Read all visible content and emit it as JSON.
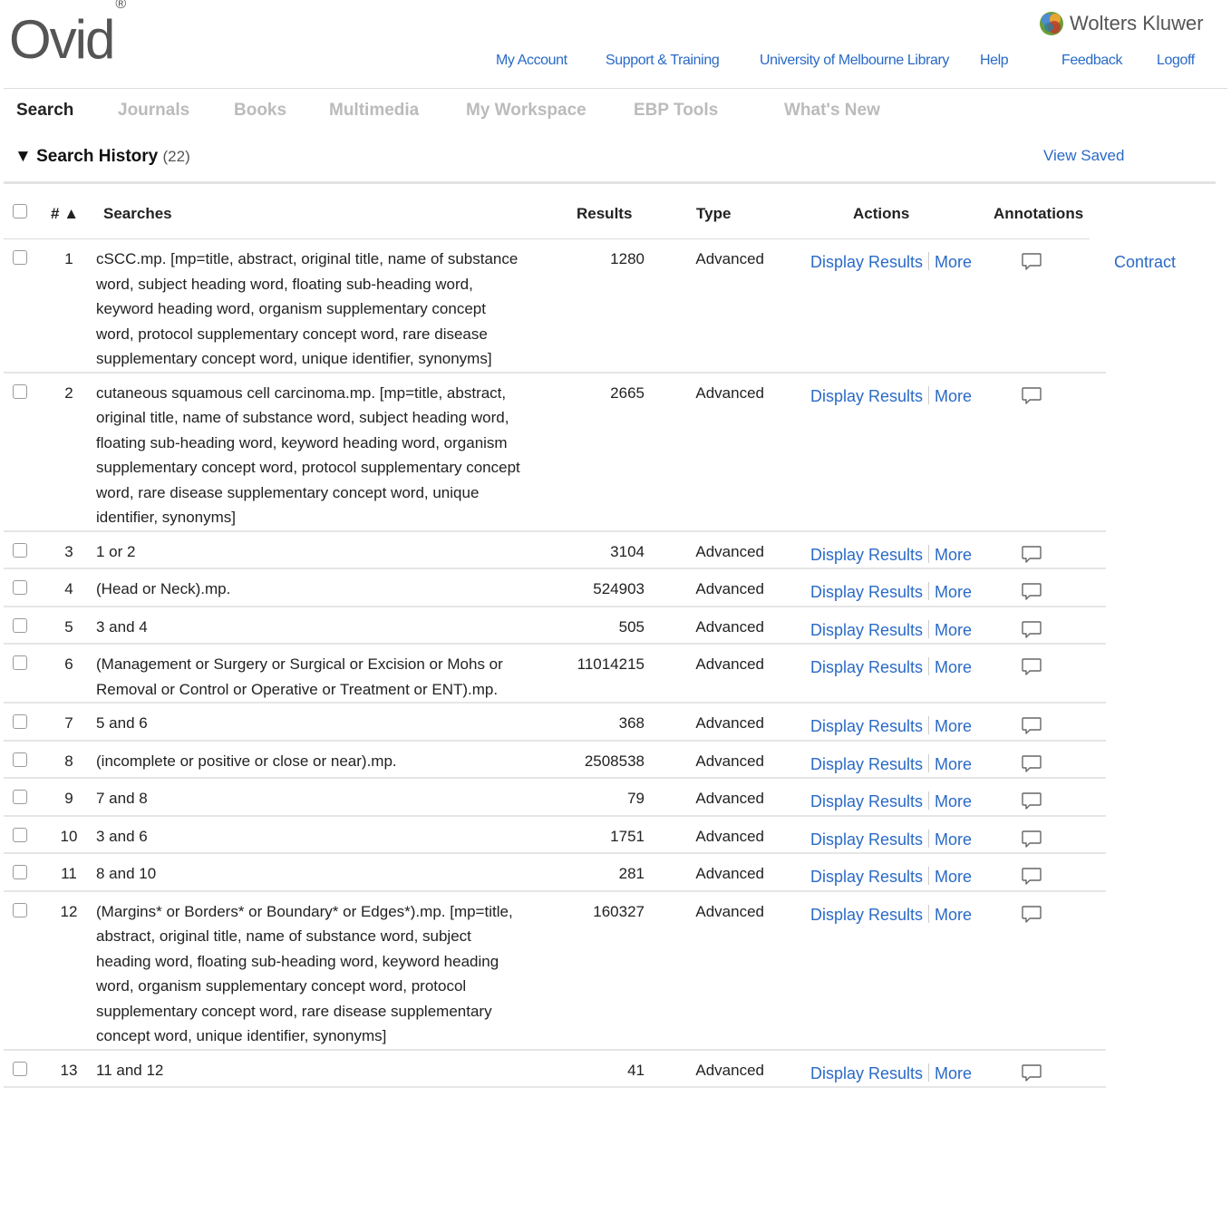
{
  "header": {
    "logo": "Ovid",
    "logo_mark": "®",
    "brand": "Wolters Kluwer",
    "brand_icon": "wolters-kluwer-logo-icon",
    "links": [
      "My Account",
      "Support & Training",
      "University of Melbourne Library",
      "Help",
      "Feedback",
      "Logoff"
    ]
  },
  "nav": {
    "tabs": [
      "Search",
      "Journals",
      "Books",
      "Multimedia",
      "My Workspace",
      "EBP Tools",
      "What's New"
    ],
    "active": "Search"
  },
  "search_history": {
    "title": "Search History",
    "count": "(22)",
    "view_saved": "View Saved",
    "contract": "Contract",
    "columns": {
      "num": "#",
      "sort_icon": "▲",
      "searches": "Searches",
      "results": "Results",
      "type": "Type",
      "actions": "Actions",
      "annotations": "Annotations"
    },
    "action_labels": {
      "display": "Display Results",
      "more": "More"
    },
    "rows": [
      {
        "num": "1",
        "search": "cSCC.mp. [mp=title, abstract, original title, name of substance word, subject heading word, floating sub-heading word, keyword heading word, organism supplementary concept word, protocol supplementary concept word, rare disease supplementary concept word, unique identifier, synonyms]",
        "results": "1280",
        "type": "Advanced"
      },
      {
        "num": "2",
        "search": "cutaneous squamous cell carcinoma.mp. [mp=title, abstract, original title, name of substance word, subject heading word, floating sub-heading word, keyword heading word, organism supplementary concept word, protocol supplementary concept word, rare disease supplementary concept word, unique identifier, synonyms]",
        "results": "2665",
        "type": "Advanced"
      },
      {
        "num": "3",
        "search": "1 or 2",
        "results": "3104",
        "type": "Advanced"
      },
      {
        "num": "4",
        "search": "(Head or Neck).mp.",
        "results": "524903",
        "type": "Advanced"
      },
      {
        "num": "5",
        "search": "3 and 4",
        "results": "505",
        "type": "Advanced"
      },
      {
        "num": "6",
        "search": "(Management or Surgery or Surgical or Excision or Mohs or Removal or Control or Operative or Treatment or ENT).mp.",
        "results": "11014215",
        "type": "Advanced"
      },
      {
        "num": "7",
        "search": "5 and 6",
        "results": "368",
        "type": "Advanced"
      },
      {
        "num": "8",
        "search": "(incomplete or positive or close or near).mp.",
        "results": "2508538",
        "type": "Advanced"
      },
      {
        "num": "9",
        "search": "7 and 8",
        "results": "79",
        "type": "Advanced"
      },
      {
        "num": "10",
        "search": "3 and 6",
        "results": "1751",
        "type": "Advanced"
      },
      {
        "num": "11",
        "search": "8 and 10",
        "results": "281",
        "type": "Advanced"
      },
      {
        "num": "12",
        "search": "(Margins* or Borders* or Boundary* or Edges*).mp. [mp=title, abstract, original title, name of substance word, subject heading word, floating sub-heading word, keyword heading word, organism supplementary concept word, protocol supplementary concept word, rare disease supplementary concept word, unique identifier, synonyms]",
        "results": "160327",
        "type": "Advanced"
      },
      {
        "num": "13",
        "search": "11 and 12",
        "results": "41",
        "type": "Advanced"
      }
    ]
  },
  "colors": {
    "link": "#2a6ac6",
    "inactive_tab": "#bbbbbb",
    "text": "#222222"
  }
}
